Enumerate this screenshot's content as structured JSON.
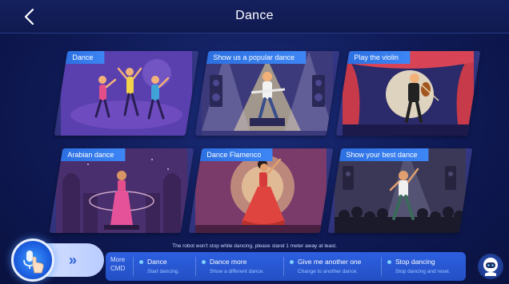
{
  "header": {
    "title": "Dance"
  },
  "cards": [
    {
      "label": "Dance"
    },
    {
      "label": "Show us a popular dance"
    },
    {
      "label": "Play the violin"
    },
    {
      "label": "Arabian dance"
    },
    {
      "label": "Dance Flamenco"
    },
    {
      "label": "Show your best dance"
    }
  ],
  "hint": "The robot won't stop while dancing, please stand 1 meter away at least.",
  "command_bar": {
    "more_label_line1": "More",
    "more_label_line2": "CMD",
    "commands": [
      {
        "title": "Dance",
        "subtitle": "Start dancing."
      },
      {
        "title": "Dance more",
        "subtitle": "Show a different dance."
      },
      {
        "title": "Give me another one",
        "subtitle": "Change to another dance."
      },
      {
        "title": "Stop dancing",
        "subtitle": "Stop dancing and reset."
      }
    ]
  },
  "colors": {
    "accent": "#2b6fe0",
    "background": "#101a50",
    "card": "#3a3f92"
  }
}
